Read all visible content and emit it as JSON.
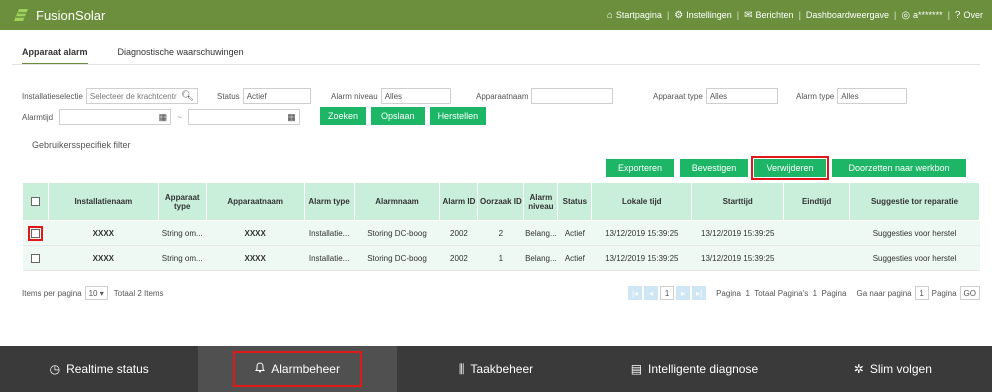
{
  "app": {
    "title": "FusionSolar"
  },
  "topnav": [
    {
      "label": "Startpagina",
      "icon": "home-icon",
      "glyph": "⌂"
    },
    {
      "label": "Instellingen",
      "icon": "gear-icon",
      "glyph": "⚙"
    },
    {
      "label": "Berichten",
      "icon": "mail-icon",
      "glyph": "✉"
    },
    {
      "label": "Dashboardweergave",
      "icon": "",
      "glyph": ""
    },
    {
      "label": "a*******",
      "icon": "user-icon",
      "glyph": "◎"
    },
    {
      "label": "Over",
      "icon": "info-icon",
      "glyph": "?"
    }
  ],
  "tabs": [
    {
      "label": "Apparaat alarm",
      "active": true
    },
    {
      "label": "Diagnostische waarschuwingen",
      "active": false
    }
  ],
  "filters": {
    "installatieselectie": {
      "label": "Installatieselectie",
      "placeholder": "Selecteer de krachtcentr"
    },
    "status": {
      "label": "Status",
      "value": "Actief"
    },
    "alarm_niveau": {
      "label": "Alarm niveau",
      "value": "Alles"
    },
    "apparaatnaam": {
      "label": "Apparaatnaam",
      "value": ""
    },
    "apparaat_type": {
      "label": "Apparaat type",
      "value": "Alles"
    },
    "alarm_type": {
      "label": "Alarm type",
      "value": "Alles"
    },
    "alarmtijd": {
      "label": "Alarmtijd",
      "sep": "~"
    },
    "buttons": {
      "search": "Zoeken",
      "save": "Opslaan",
      "reset": "Herstellen"
    }
  },
  "user_filter": "Gebruikersspecifiek filter",
  "actions": {
    "export": "Exporteren",
    "confirm": "Bevestigen",
    "delete": "Verwijderen",
    "forward": "Doorzetten naar werkbon"
  },
  "table": {
    "headers": [
      "Installatienaam",
      "Apparaat type",
      "Apparaatnaam",
      "Alarm type",
      "Alarmnaam",
      "Alarm ID",
      "Oorzaak ID",
      "Alarm niveau",
      "Status",
      "Lokale tijd",
      "Starttijd",
      "Eindtijd",
      "Suggestie tor reparatie"
    ],
    "rows": [
      [
        "XXXX",
        "String om...",
        "XXXX",
        "Installatie...",
        "Storing DC-boog",
        "2002",
        "2",
        "Belang...",
        "Actief",
        "13/12/2019 15:39:25",
        "13/12/2019 15:39:25",
        "",
        "Suggesties voor herstel"
      ],
      [
        "XXXX",
        "String om...",
        "XXXX",
        "Installatie...",
        "Storing DC-boog",
        "2002",
        "1",
        "Belang...",
        "Actief",
        "13/12/2019 15:39:25",
        "13/12/2019 15:39:25",
        "",
        "Suggesties voor herstel"
      ]
    ]
  },
  "pager": {
    "items_per_page_label": "Items per pagina",
    "items_per_page": "10",
    "total": "Totaal 2 Items",
    "current_page": "1",
    "summary": "Pagina  1  Totaal Pagina's  1  Pagina",
    "goto_label": "Ga naar pagina",
    "goto_value": "1",
    "page_word": "Pagina",
    "go": "GO"
  },
  "bottom_nav": [
    {
      "label": "Realtime status",
      "icon": "gauge-icon",
      "glyph": "◷",
      "active": false
    },
    {
      "label": "Alarmbeheer",
      "icon": "bell-icon",
      "glyph": "♫",
      "active": true
    },
    {
      "label": "Taakbeheer",
      "icon": "task-icon",
      "glyph": "⫼",
      "active": false
    },
    {
      "label": "Intelligente diagnose",
      "icon": "diagnose-icon",
      "glyph": "▤",
      "active": false
    },
    {
      "label": "Slim volgen",
      "icon": "settings-icon",
      "glyph": "✲",
      "active": false
    }
  ],
  "colors": {
    "topbar": "#6b8f3c",
    "button_green": "#1db566",
    "header_bg": "#c9efdb",
    "highlight": "#e01818",
    "warning": "#f0a030",
    "bottombar": "#3a3a3a"
  }
}
